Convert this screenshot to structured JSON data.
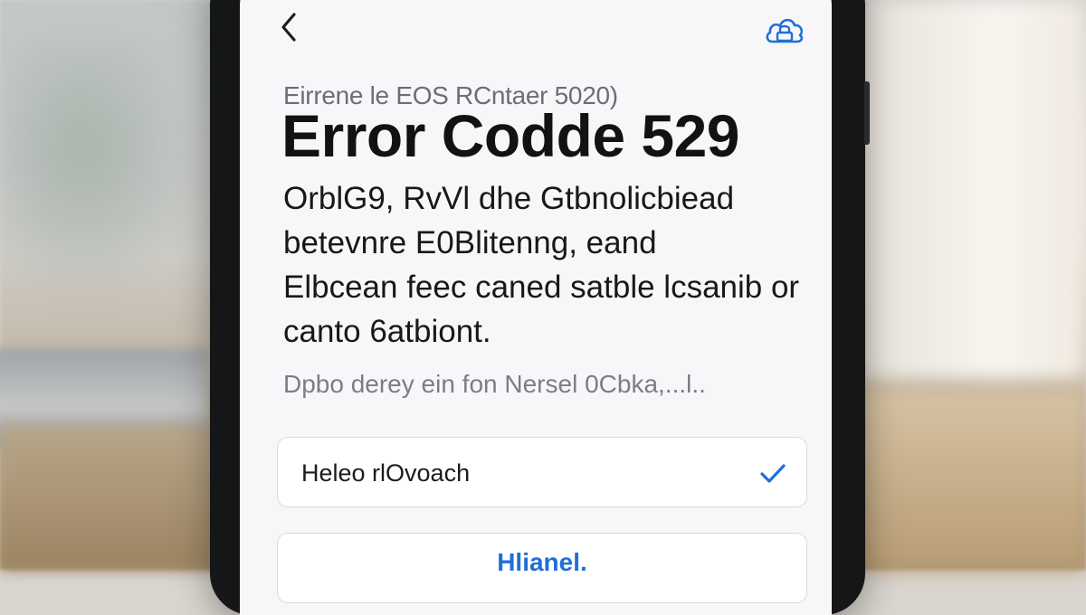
{
  "icons": {
    "back": "chevron-left-icon",
    "top_right": "cloud-lock-icon",
    "option_check": "checkmark-icon"
  },
  "colors": {
    "accent": "#1f6fd6",
    "title": "#111214",
    "subtitle": "#6b6e73",
    "hint": "#7b7e83",
    "screen_background": "#f7f7f9"
  },
  "header": {
    "subtitle": "Eirrene le EOS RCntaer 5020)",
    "title": "Error Codde 529"
  },
  "message": {
    "lines": [
      "OrblG9, RvVl dhe Gtbnolicbiead",
      "betevnre E0Blitenng, eand",
      "Elbcean feec caned satble lcsanib or",
      "canto 6atbiont."
    ]
  },
  "hint": "Dpbo derey ein fon Nersel 0Cbka,...l..",
  "option": {
    "label": "Heleo rlOvoach",
    "selected": true
  },
  "action": {
    "label": "Hlianel."
  }
}
